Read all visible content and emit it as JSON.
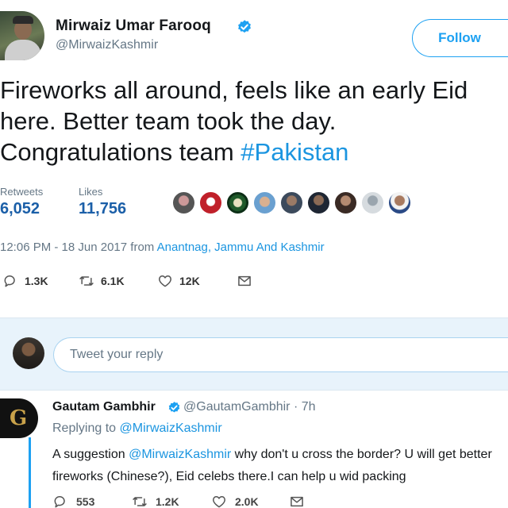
{
  "tweet": {
    "author": {
      "name": "Mirwaiz Umar Farooq",
      "handle": "@MirwaizKashmir"
    },
    "follow_label": "Follow",
    "text": {
      "line1": "Fireworks all around, feels like an early Eid",
      "line2": "here. Better team took the day.",
      "line3_prefix": "Congratulations team ",
      "hashtag": "#Pakistan"
    },
    "stats": {
      "retweets_label": "Retweets",
      "retweets": "6,052",
      "likes_label": "Likes",
      "likes": "11,756"
    },
    "timestamp": {
      "time": "12:06 PM - 18 Jun 2017",
      "from": "from",
      "location": "Anantnag, Jammu And Kashmir"
    },
    "actions": {
      "replies": "1.3K",
      "retweets": "6.1K",
      "likes": "12K"
    }
  },
  "reply_box": {
    "placeholder": "Tweet your reply"
  },
  "reply": {
    "author": {
      "name": "Gautam Gambhir",
      "handle_time": "@GautamGambhir · 7h"
    },
    "replying_to_label": "Replying to",
    "replying_to": "@MirwaizKashmir",
    "text": {
      "line1_prefix": "A suggestion ",
      "mention": "@MirwaizKashmir",
      "line1_suffix": " why don't u cross the border? U will get better",
      "line2": "fireworks (Chinese?), Eid celebs there.I can help u wid packing"
    },
    "actions": {
      "replies": "553",
      "retweets": "1.2K",
      "likes": "2.0K"
    }
  },
  "colors": {
    "accent": "#1da1f2",
    "link": "#1b95e0",
    "muted": "#657786",
    "reply_bar": "#e8f3fb"
  }
}
